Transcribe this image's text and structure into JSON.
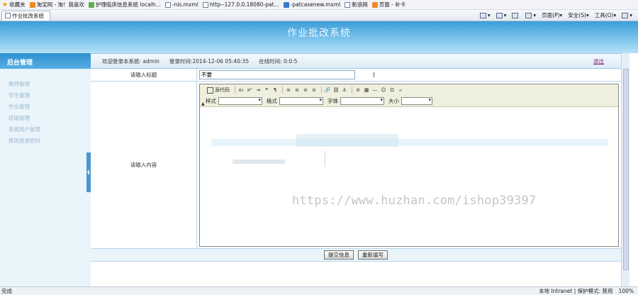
{
  "browser": {
    "favorites_label": "收藏夹",
    "favorites": [
      "淘宝网 - 淘！我喜欢",
      "护理临床信息系统 localh...",
      "-nis.mxml",
      "http--127.0.0.18080-pat...",
      "-patcasenew.mxml",
      "新浪网",
      "页面 - 补卡"
    ],
    "tab_title": "作业批改系统",
    "commands": [
      "页面(P)",
      "安全(S)",
      "工具(O)"
    ],
    "status_left": "完成",
    "status_zone": "本地 Intranet | 保护模式: 禁用",
    "zoom": "100%"
  },
  "app": {
    "title": "作业批改系统"
  },
  "sidebar": {
    "heading": "后台管理",
    "items": [
      "教师管理",
      "学生管理",
      "作业管理",
      "班级管理",
      "系统用户管理",
      "修改登录密码"
    ]
  },
  "info": {
    "welcome": "欢迎登录本系统: admin",
    "login_time": "登录时间:2014-12-06 05:40:35",
    "online_time": "在线时间: 0:0:5",
    "logout": "退出"
  },
  "form": {
    "title_label": "请输入标题",
    "title_value": "不要",
    "content_label": "请输入内容",
    "submit": "提交信息",
    "reset": "重新填写"
  },
  "editor": {
    "source_label": "源代码",
    "style_label": "样式",
    "format_label": "格式",
    "font_label": "字体",
    "size_label": "大小"
  },
  "watermark": "https://www.huzhan.com/ishop39397"
}
